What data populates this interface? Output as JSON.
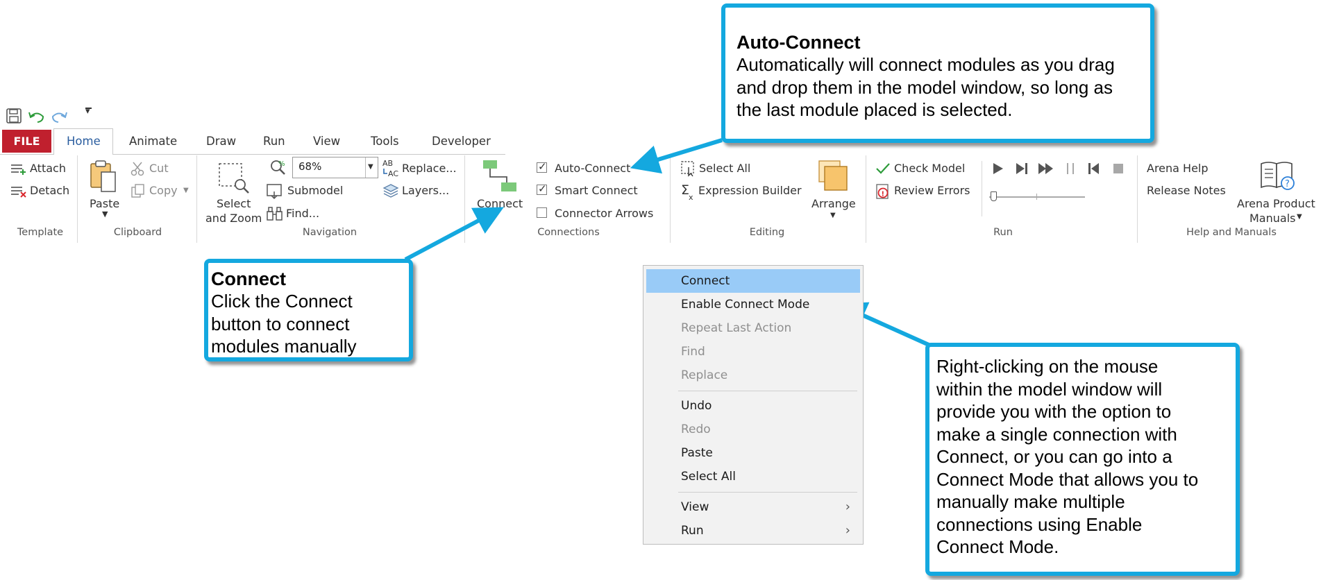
{
  "colors": {
    "callout_border": "#14a8df",
    "file_tab": "#c0202e",
    "menu_highlight": "#99cbf7",
    "group_sep": "#d8d8d8"
  },
  "quick_access": {
    "icons": [
      "save-icon",
      "undo-icon",
      "redo-icon",
      "customize-qat-icon"
    ],
    "dropdown_glyph": "▾"
  },
  "tabs": [
    {
      "label": "FILE"
    },
    {
      "label": "Home"
    },
    {
      "label": "Animate"
    },
    {
      "label": "Draw"
    },
    {
      "label": "Run"
    },
    {
      "label": "View"
    },
    {
      "label": "Tools"
    },
    {
      "label": "Developer"
    }
  ],
  "ribbon": {
    "template": {
      "attach": "Attach",
      "detach": "Detach",
      "group": "Template"
    },
    "clipboard": {
      "paste": "Paste",
      "cut": "Cut",
      "copy": "Copy",
      "group": "Clipboard"
    },
    "navigation": {
      "select_zoom_1": "Select",
      "select_zoom_2": "and Zoom",
      "zoom_value": "68%",
      "submodel": "Submodel",
      "find": "Find...",
      "replace": "Replace...",
      "layers": "Layers...",
      "group": "Navigation"
    },
    "connect": {
      "label": "Connect"
    },
    "connections": {
      "auto_connect": "Auto-Connect",
      "smart_connect": "Smart Connect",
      "connector_arrows": "Connector Arrows",
      "group": "Connections",
      "auto_checked": true,
      "smart_checked": true,
      "arrows_checked": false
    },
    "editing": {
      "select_all": "Select All",
      "expression_builder": "Expression Builder",
      "arrange": "Arrange",
      "group": "Editing"
    },
    "run": {
      "check_model": "Check Model",
      "review_errors": "Review Errors",
      "group": "Run",
      "controls": [
        "play-icon",
        "step-icon",
        "fast-forward-icon",
        "pause-icon",
        "go-to-start-icon",
        "stop-icon"
      ]
    },
    "help": {
      "arena_help": "Arena Help",
      "release_notes": "Release Notes",
      "manuals_1": "Arena Product",
      "manuals_2": "Manuals",
      "group": "Help and Manuals"
    }
  },
  "callouts": {
    "auto_connect": {
      "title": "Auto-Connect",
      "lines": [
        "Automatically will connect modules as you drag",
        "and drop them in the model window, so long as",
        "the last module placed is selected."
      ]
    },
    "connect": {
      "title": "Connect",
      "lines": [
        "Click the Connect",
        "button to connect",
        "modules manually"
      ]
    },
    "right_click": {
      "lines": [
        "Right-clicking on the mouse",
        "within the model window will",
        "provide you with the option to",
        "make a single connection with",
        "Connect, or you can go into a",
        "Connect Mode that allows you to",
        "manually make multiple",
        "connections using  Enable",
        "Connect Mode."
      ]
    }
  },
  "context_menu": {
    "items": [
      {
        "label": "Connect",
        "highlighted": true
      },
      {
        "label": "Enable Connect Mode"
      },
      {
        "label": "Repeat Last Action",
        "disabled": true
      },
      {
        "label": "Find",
        "disabled": true
      },
      {
        "label": "Replace",
        "disabled": true
      },
      {
        "label": "Undo"
      },
      {
        "label": "Redo",
        "disabled": true
      },
      {
        "label": "Paste"
      },
      {
        "label": "Select All"
      },
      {
        "label": "View",
        "submenu": true
      },
      {
        "label": "Run",
        "submenu": true
      }
    ],
    "submenu_glyph": "›"
  }
}
